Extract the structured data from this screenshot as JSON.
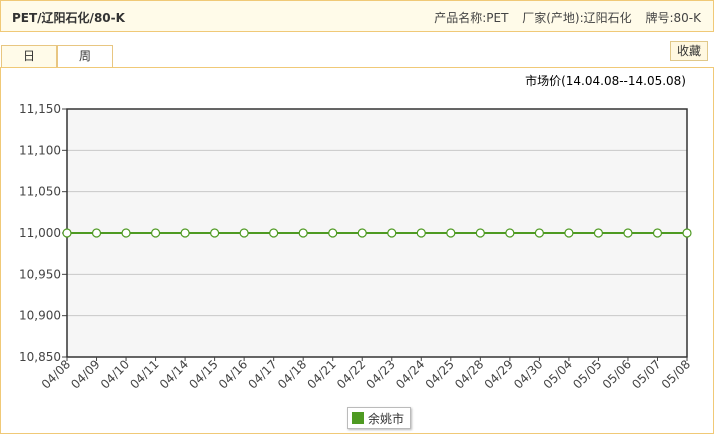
{
  "header": {
    "title": "PET/辽阳石化/80-K",
    "product": "产品名称:PET",
    "maker": "厂家(产地):辽阳石化",
    "grade": "牌号:80-K"
  },
  "tabs": [
    {
      "label": "日",
      "active": true
    },
    {
      "label": "周",
      "active": false
    }
  ],
  "favorite_label": "收藏",
  "colors": {
    "series": "#4e9a22",
    "plot_bg": "#f6f6f6",
    "border": "#f0c977"
  },
  "chart_data": {
    "type": "line",
    "title": "市场价(14.04.08--14.05.08)",
    "xlabel": "",
    "ylabel": "",
    "categories": [
      "04/08",
      "04/09",
      "04/10",
      "04/11",
      "04/14",
      "04/15",
      "04/16",
      "04/17",
      "04/18",
      "04/21",
      "04/22",
      "04/23",
      "04/24",
      "04/25",
      "04/28",
      "04/29",
      "04/30",
      "05/04",
      "05/05",
      "05/06",
      "05/07",
      "05/08"
    ],
    "series": [
      {
        "name": "余姚市",
        "values": [
          11000,
          11000,
          11000,
          11000,
          11000,
          11000,
          11000,
          11000,
          11000,
          11000,
          11000,
          11000,
          11000,
          11000,
          11000,
          11000,
          11000,
          11000,
          11000,
          11000,
          11000,
          11000
        ]
      }
    ],
    "yticks": [
      10850,
      10900,
      10950,
      11000,
      11050,
      11100,
      11150
    ],
    "ytick_labels": [
      "10,850",
      "10,900",
      "10,950",
      "11,000",
      "11,050",
      "11,100",
      "11,150"
    ],
    "ylim": [
      10850,
      11150
    ],
    "grid": true,
    "legend": "bottom-center"
  }
}
